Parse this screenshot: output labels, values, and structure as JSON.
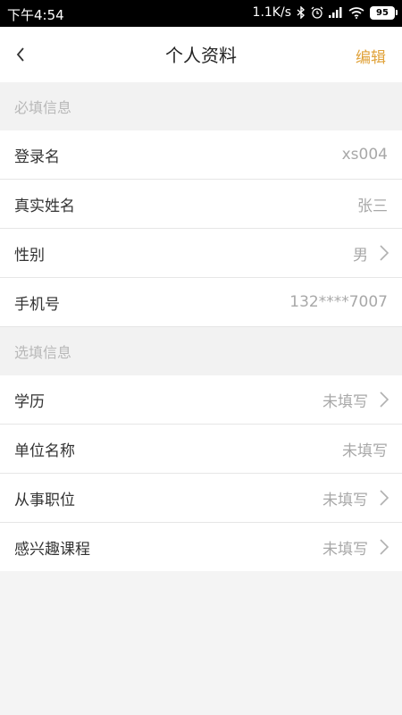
{
  "status_bar": {
    "time": "下午4:54",
    "network_speed": "1.1K/s",
    "battery": "95",
    "icons": [
      "bluetooth-icon",
      "alarm-icon",
      "signal-icon",
      "wifi-icon",
      "battery-icon"
    ]
  },
  "header": {
    "back_icon": "chevron-left-icon",
    "title": "个人资料",
    "edit_label": "编辑"
  },
  "required_section": {
    "title": "必填信息",
    "rows": [
      {
        "label": "登录名",
        "value": "xs004"
      },
      {
        "label": "真实姓名",
        "value": "张三"
      },
      {
        "label": "性别",
        "value": "男"
      },
      {
        "label": "手机号",
        "value": "132****7007"
      }
    ]
  },
  "optional_section": {
    "title": "选填信息",
    "rows": [
      {
        "label": "学历",
        "value": "未填写"
      },
      {
        "label": "单位名称",
        "value": "未填写"
      },
      {
        "label": "从事职位",
        "value": "未填写"
      },
      {
        "label": "感兴趣课程",
        "value": "未填写"
      }
    ]
  },
  "colors": {
    "accent": "#e0a23a",
    "section_bg": "#f2f2f2",
    "label": "#333333",
    "value": "#a8a8a8"
  }
}
